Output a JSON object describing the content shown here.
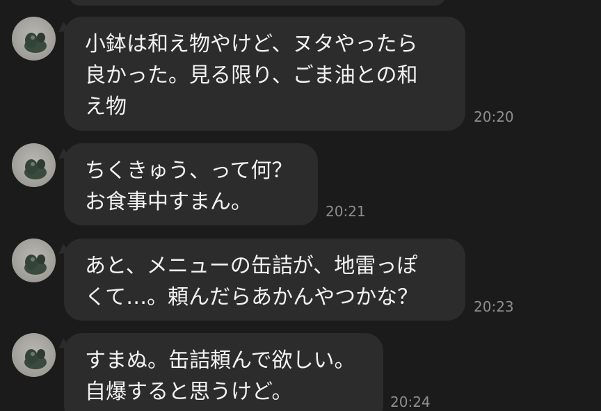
{
  "avatar_icon": "user-avatar-photo",
  "colors": {
    "background": "#1b1b1b",
    "bubble": "#2c2c2c",
    "text": "#f2f2f2",
    "timestamp": "#8e8e8e"
  },
  "messages": [
    {
      "lines": [
        "小鉢は和え物やけど、ヌタやったら",
        "良かった。見る限り、ごま油との和",
        "え物"
      ],
      "time": "20:20"
    },
    {
      "lines": [
        "ちくきゅう、って何？",
        "お食事中すまん。"
      ],
      "time": "20:21"
    },
    {
      "lines": [
        "あと、メニューの缶詰が、地雷っぽ",
        "くて…。頼んだらあかんやつかな？"
      ],
      "time": "20:23"
    },
    {
      "lines": [
        "すまぬ。缶詰頼んで欲しい。",
        "自爆すると思うけど。"
      ],
      "time": "20:24"
    }
  ]
}
